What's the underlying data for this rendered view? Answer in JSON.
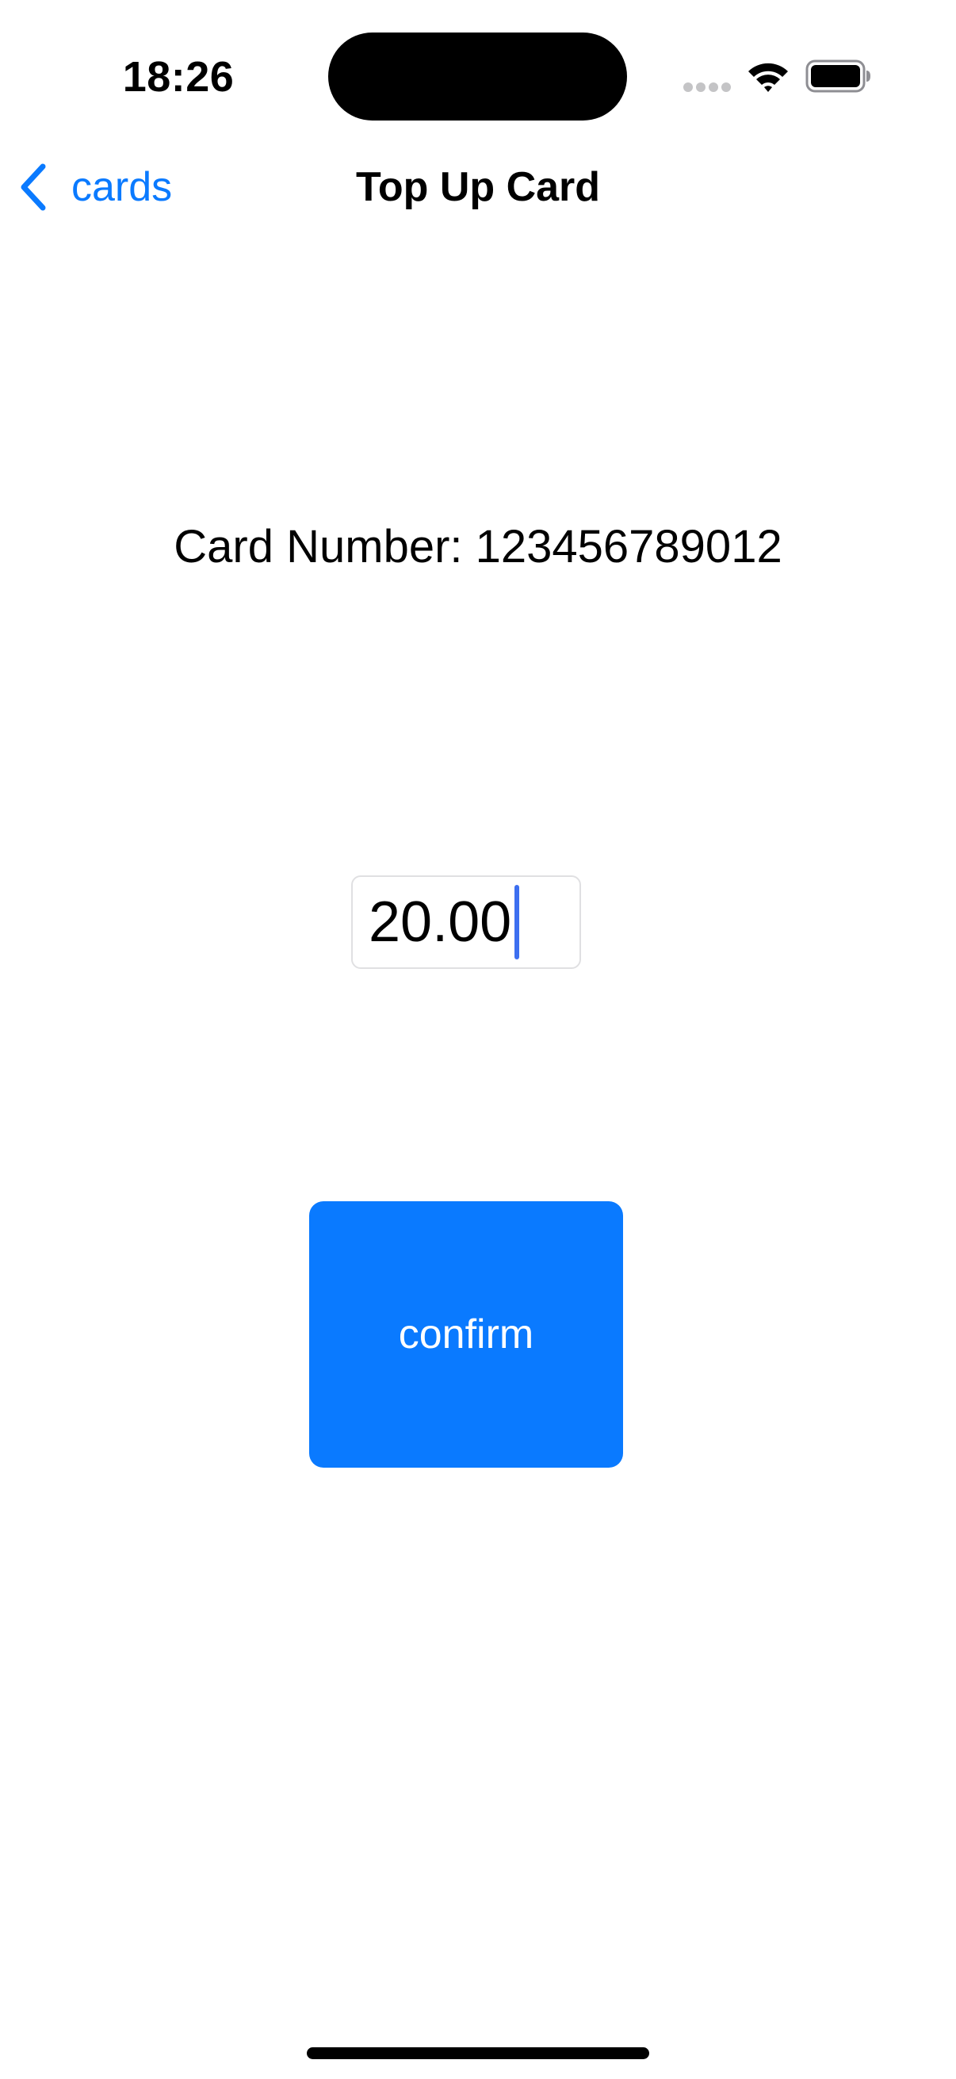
{
  "status_bar": {
    "time": "18:26",
    "icons": [
      "cellular-signal-icon",
      "wifi-icon",
      "battery-icon"
    ]
  },
  "nav": {
    "back_label": "cards",
    "back_icon": "chevron-left-icon",
    "title": "Top Up Card"
  },
  "content": {
    "card_number_text": "Card Number: 123456789012",
    "amount_value": "20.00",
    "confirm_label": "confirm"
  },
  "colors": {
    "accent": "#0a7aff",
    "button_text": "#ffffff",
    "caret": "#3d6ff0",
    "field_border": "#e0e0e2"
  }
}
